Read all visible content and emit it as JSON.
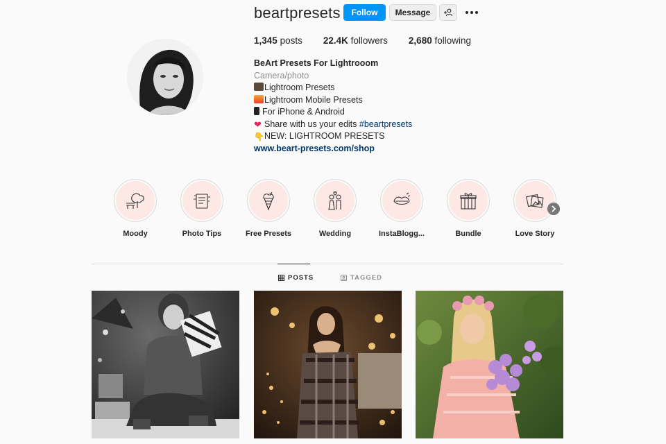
{
  "header": {
    "username": "beartpresets",
    "follow_label": "Follow",
    "message_label": "Message"
  },
  "stats": {
    "posts_count": "1,345",
    "posts_label": "posts",
    "followers_count": "22.4K",
    "followers_label": "followers",
    "following_count": "2,680",
    "following_label": "following"
  },
  "bio": {
    "name": "BeArt Presets For Lightrooom",
    "category": "Camera/photo",
    "lines": [
      "Lightroom Presets",
      "Lightroom Mobile Presets",
      "For iPhone & Android",
      "Share with us your edits ",
      "NEW: LIGHTROOM PRESETS"
    ],
    "hashtag": "#beartpresets",
    "link": "www.beart-presets.com/shop",
    "emoji_icons": [
      "camera-flash-icon",
      "sunset-icon",
      "mobile-phone-icon",
      "heart-icon",
      "pointing-down-icon"
    ]
  },
  "highlights": [
    {
      "label": "Moody",
      "icon": "tree-bench-icon"
    },
    {
      "label": "Photo Tips",
      "icon": "notes-icon"
    },
    {
      "label": "Free Presets",
      "icon": "ice-cream-icon"
    },
    {
      "label": "Wedding",
      "icon": "couple-icon"
    },
    {
      "label": "InstaBlogg...",
      "icon": "mouth-icon"
    },
    {
      "label": "Bundle",
      "icon": "gift-icon"
    },
    {
      "label": "Love Story",
      "icon": "photos-icon"
    }
  ],
  "tabs": {
    "posts": "POSTS",
    "tagged": "TAGGED"
  },
  "colors": {
    "accent": "#0095f6",
    "link": "#00376b",
    "highlight_bg": "#fde8e6"
  }
}
